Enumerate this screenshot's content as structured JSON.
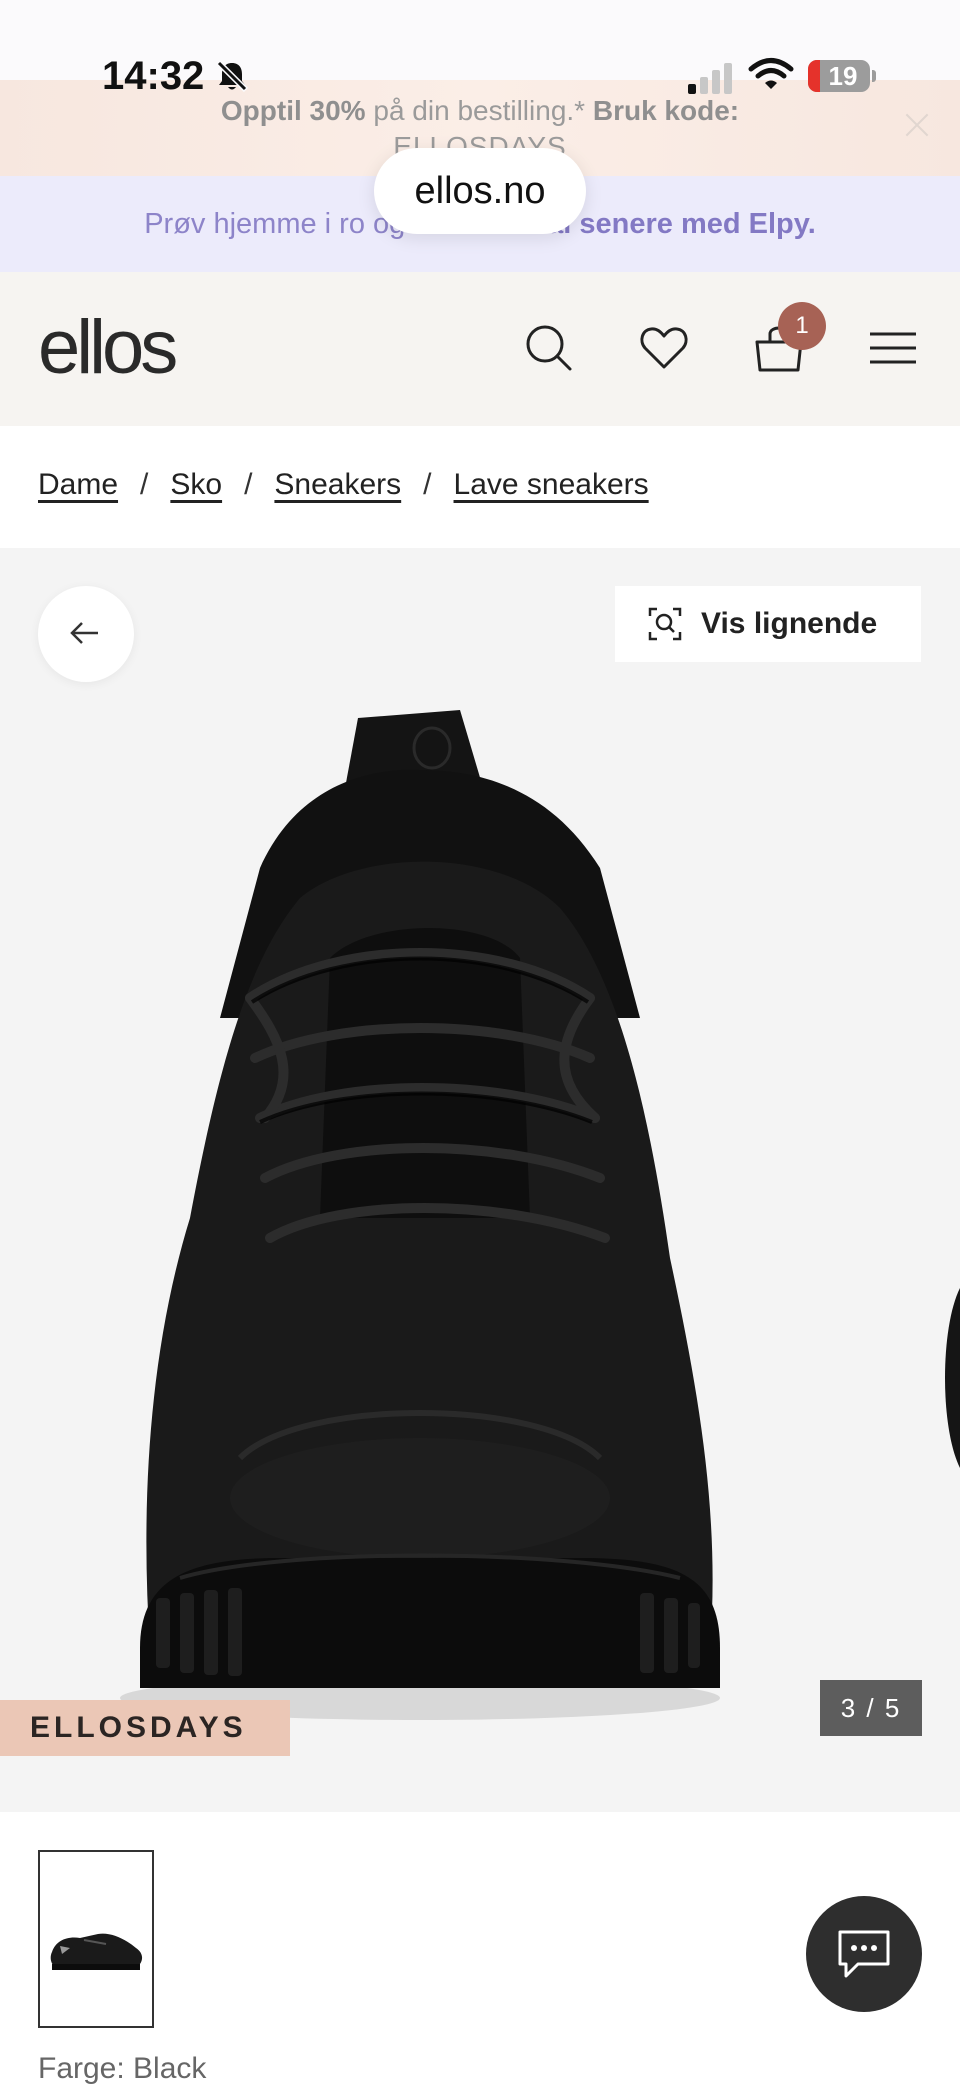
{
  "status_bar": {
    "time": "14:32",
    "battery": "19",
    "icons": [
      "bell-off-icon",
      "signal-icon",
      "wifi-icon",
      "battery-icon"
    ]
  },
  "promo": {
    "prefix_bold": "Opptil 30%",
    "middle": " på din bestilling.* ",
    "suffix_bold": "Bruk kode:",
    "code": "ELLOSDAYS"
  },
  "url": "ellos.no",
  "elpy": {
    "text": "Prøv hjemme i ro og mak – betal senere med Elpy.",
    "before": "Prøv hjemme i ro og ",
    "bold": "mak – betal senere med Elpy."
  },
  "header": {
    "logo": "ellos",
    "cart_count": "1",
    "icons": [
      "search-icon",
      "heart-icon",
      "bag-icon",
      "menu-icon"
    ]
  },
  "breadcrumb": {
    "items": [
      "Dame",
      "Sko",
      "Sneakers",
      "Lave sneakers"
    ],
    "separator": "/"
  },
  "gallery": {
    "similar_label": "Vis lignende",
    "tag": "ELLOSDAYS",
    "counter": "3 / 5"
  },
  "product": {
    "color_label": "Farge: Black"
  },
  "colors": {
    "tag_bg": "#ebc7b6",
    "badge": "#a76255",
    "elpy_text": "#8379c4",
    "header_bg": "#f6f4f1"
  }
}
